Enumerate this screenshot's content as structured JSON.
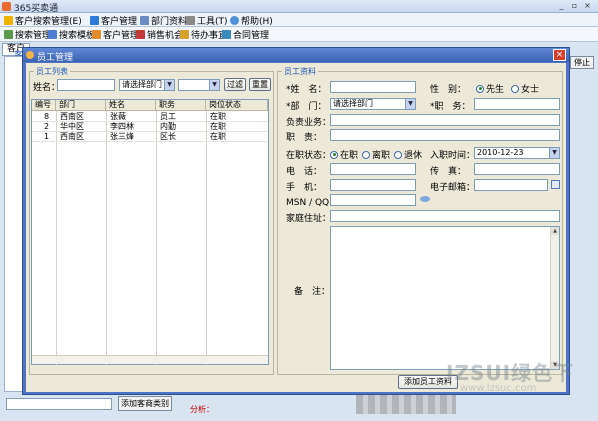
{
  "app": {
    "title": "365买卖通"
  },
  "window_controls": {
    "minimize": "_",
    "restore": "▫",
    "close": "×"
  },
  "menubar": [
    {
      "label": "客户搜索管理(E)",
      "color": "#f0b400"
    },
    {
      "label": "客户管理",
      "color": "#2d7bd6"
    },
    {
      "label": "部门资料",
      "color": "#6a8cc2"
    },
    {
      "label": "工具(T)",
      "color": "#8a8a8a"
    },
    {
      "label": "帮助(H)",
      "color": "#4f8fda"
    }
  ],
  "toolbar": [
    {
      "label": "搜索管理",
      "color": "#5a9a4a"
    },
    {
      "label": "搜索模板",
      "color": "#4f7ed0"
    },
    {
      "label": "客户管理",
      "color": "#e38a2c"
    },
    {
      "label": "销售机会",
      "color": "#c23a3a"
    },
    {
      "label": "待办事宜",
      "color": "#d7a02c"
    },
    {
      "label": "合同管理",
      "color": "#3a8ac2"
    }
  ],
  "background": {
    "tabs": [
      "客户",
      "客"
    ],
    "stop_button": "停止",
    "add_customer_type_button": "添加客商类别",
    "analysis_label": "分析："
  },
  "watermark": {
    "main": "IZSUI绿色下",
    "sub": "www.lzsuc.com"
  },
  "dialog": {
    "title": "员工管理",
    "close": "×",
    "list_group": {
      "legend": "员工列表",
      "name_label": "姓名：",
      "name_value": "",
      "dept_select": "请选择部门",
      "status_select": "",
      "filter_button": "过滤",
      "reset_button": "重置",
      "columns": [
        "编号",
        "部门",
        "姓名",
        "职务",
        "岗位状态"
      ],
      "rows": [
        [
          "8",
          "西南区",
          "张薇",
          "员工",
          "在职"
        ],
        [
          "2",
          "华中区",
          "李四林",
          "内勤",
          "在职"
        ],
        [
          "1",
          "西南区",
          "张三烽",
          "区长",
          "在职"
        ]
      ]
    },
    "detail_group": {
      "legend": "员工资料",
      "name_label": "*姓　名：",
      "name_value": "",
      "gender_label": "性　别：",
      "gender_options": [
        "先生",
        "女士"
      ],
      "gender_selected": 0,
      "dept_label": "*部　门：",
      "dept_select": "请选择部门",
      "position_label": "*职　务：",
      "position_value": "",
      "business_label": "负责业务：",
      "duty_label": "职　责：",
      "status_label": "在职状态：",
      "status_options": [
        "在职",
        "离职",
        "退休"
      ],
      "status_selected": 0,
      "join_date_label": "入职时间：",
      "join_date_value": "2010-12-23",
      "phone_label": "电　话：",
      "fax_label": "传　真：",
      "mobile_label": "手　机：",
      "email_label": "电子邮箱：",
      "msn_label": "MSN / QQ：",
      "address_label": "家庭住址：",
      "remark_label": "备　注："
    },
    "add_employee_button": "添加员工资料"
  }
}
